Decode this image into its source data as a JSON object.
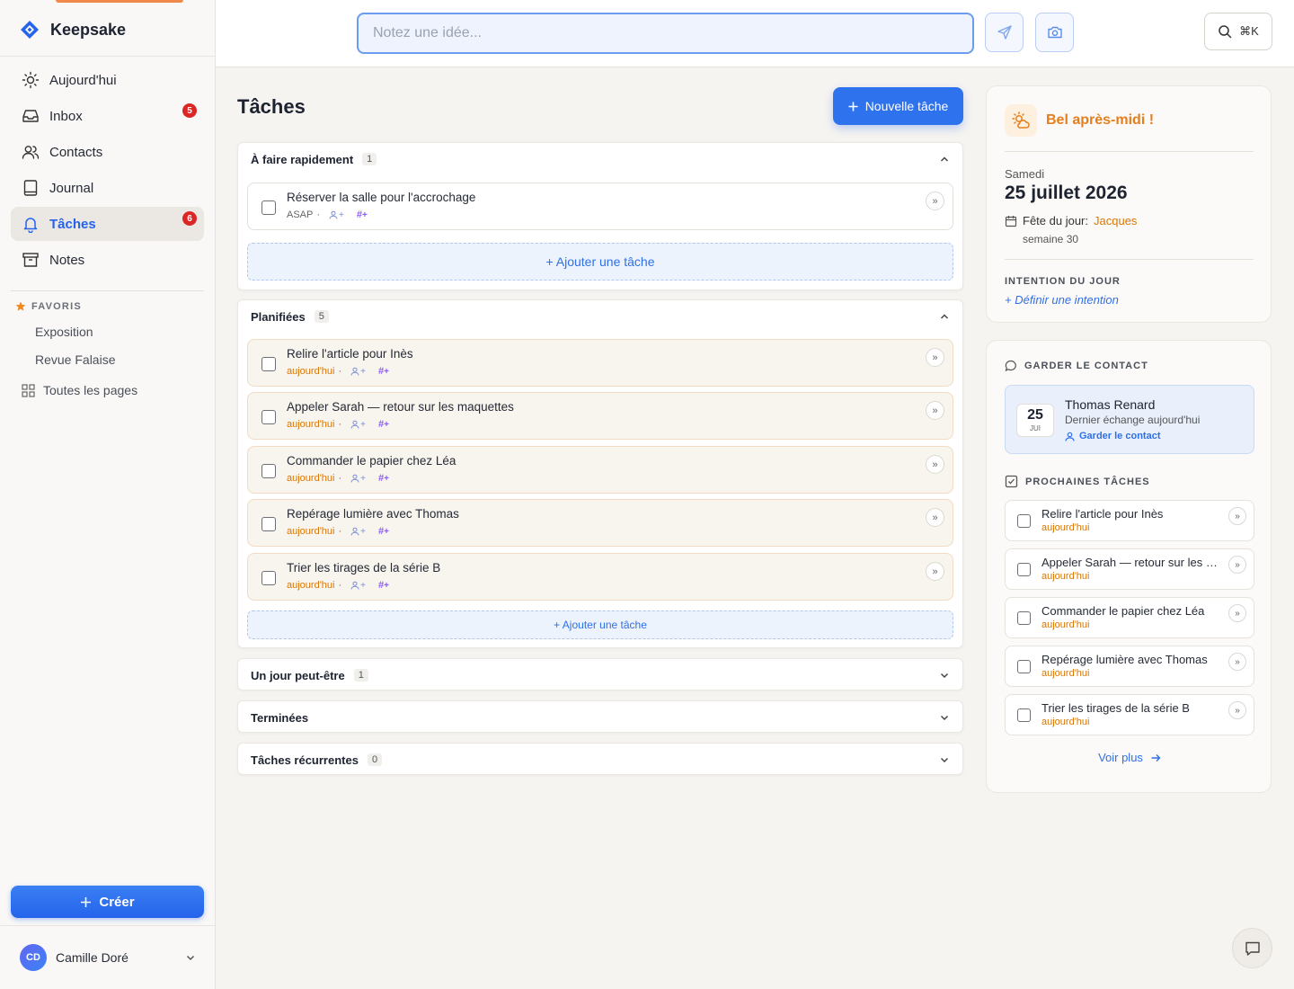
{
  "brand": {
    "name": "Keepsake"
  },
  "sidebar": {
    "items": [
      {
        "label": "Aujourd'hui",
        "icon": "sun-icon"
      },
      {
        "label": "Inbox",
        "icon": "inbox-icon",
        "badge": "5"
      },
      {
        "label": "Contacts",
        "icon": "users-icon"
      },
      {
        "label": "Journal",
        "icon": "book-icon"
      },
      {
        "label": "Tâches",
        "icon": "bell-icon",
        "badge": "6",
        "active": true
      },
      {
        "label": "Notes",
        "icon": "archive-icon"
      }
    ],
    "favorites_label": "FAVORIS",
    "favorites": [
      "Exposition",
      "Revue Falaise"
    ],
    "all_pages": "Toutes les pages",
    "create_label": "Créer",
    "user": {
      "initials": "CD",
      "name": "Camille Doré"
    }
  },
  "topbar": {
    "quick_placeholder": "Notez une idée...",
    "search_shortcut": "⌘K"
  },
  "main": {
    "title": "Tâches",
    "new_task_label": "Nouvelle tâche",
    "add_task_label": "+ Ajouter une tâche",
    "sections": {
      "quick": {
        "label": "À faire rapidement",
        "count": "1",
        "tasks": [
          {
            "title": "Réserver la salle pour l'accrochage",
            "due": "ASAP"
          }
        ]
      },
      "planned": {
        "label": "Planifiées",
        "count": "5",
        "tasks": [
          {
            "title": "Relire l'article pour Inès",
            "due": "aujourd'hui"
          },
          {
            "title": "Appeler Sarah — retour sur les maquettes",
            "due": "aujourd'hui"
          },
          {
            "title": "Commander le papier chez Léa",
            "due": "aujourd'hui"
          },
          {
            "title": "Repérage lumière avec Thomas",
            "due": "aujourd'hui"
          },
          {
            "title": "Trier les tirages de la série B",
            "due": "aujourd'hui"
          }
        ]
      },
      "someday": {
        "label": "Un jour peut-être",
        "count": "1"
      },
      "done": {
        "label": "Terminées"
      },
      "recurring": {
        "label": "Tâches récurrentes",
        "count": "0"
      }
    }
  },
  "panel": {
    "greeting": "Bel après-midi !",
    "day_name": "Samedi",
    "date": "25 juillet 2026",
    "feast_label": "Fête du jour:",
    "feast_saint": "Jacques",
    "week": "semaine 30",
    "intention_label": "INTENTION DU JOUR",
    "intention_link": "+ Définir une intention",
    "contact_label": "GARDER LE CONTACT",
    "contact": {
      "day": "25",
      "month": "JUI",
      "name": "Thomas Renard",
      "last": "Dernier échange aujourd'hui",
      "keep": "Garder le contact"
    },
    "upcoming_label": "PROCHAINES TÂCHES",
    "upcoming": [
      {
        "title": "Relire l'article pour Inès",
        "due": "aujourd'hui"
      },
      {
        "title": "Appeler Sarah — retour sur les maquettes",
        "due": "aujourd'hui"
      },
      {
        "title": "Commander le papier chez Léa",
        "due": "aujourd'hui"
      },
      {
        "title": "Repérage lumière avec Thomas",
        "due": "aujourd'hui"
      },
      {
        "title": "Trier les tirages de la série B",
        "due": "aujourd'hui"
      }
    ],
    "see_more": "Voir plus"
  },
  "colors": {
    "accent": "#2563eb",
    "today": "#d97706",
    "badge": "#dc2626",
    "greeting": "#e67e1d"
  }
}
